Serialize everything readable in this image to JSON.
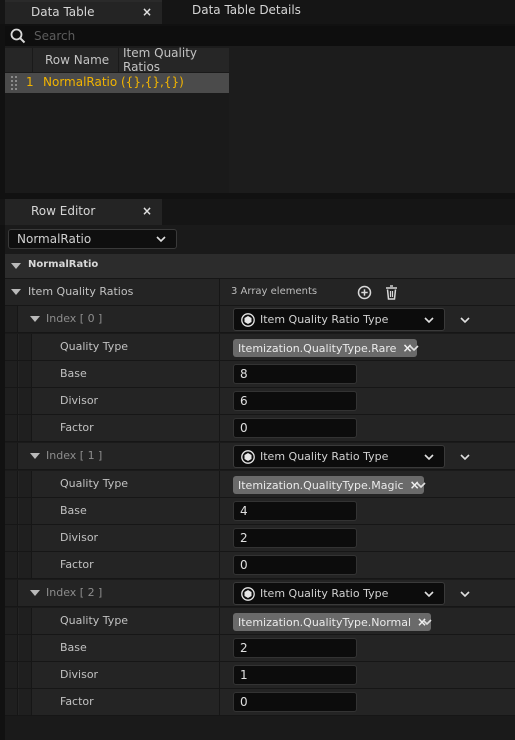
{
  "tabs": {
    "data_table": "Data Table",
    "close_glyph": "×",
    "details": "Data Table Details"
  },
  "search": {
    "placeholder": "Search"
  },
  "table": {
    "headers": [
      "Row Name",
      "Item Quality Ratios"
    ],
    "rows": [
      {
        "index": "1",
        "name": "NormalRatio",
        "value": "({},{},{})"
      }
    ]
  },
  "row_editor": {
    "tab_label": "Row Editor",
    "close_glyph": "×",
    "selected_row": "NormalRatio",
    "section_title": "NormalRatio",
    "array": {
      "label": "Item Quality Ratios",
      "count_text": "3 Array elements",
      "elements": [
        {
          "index_label": "Index [ 0 ]",
          "struct_type": "Item Quality Ratio Type",
          "fields": {
            "quality_type_label": "Quality Type",
            "quality_type_value": "Itemization.QualityType.Rare",
            "base_label": "Base",
            "base_value": "8",
            "divisor_label": "Divisor",
            "divisor_value": "6",
            "factor_label": "Factor",
            "factor_value": "0"
          }
        },
        {
          "index_label": "Index [ 1 ]",
          "struct_type": "Item Quality Ratio Type",
          "fields": {
            "quality_type_label": "Quality Type",
            "quality_type_value": "Itemization.QualityType.Magic",
            "base_label": "Base",
            "base_value": "4",
            "divisor_label": "Divisor",
            "divisor_value": "2",
            "factor_label": "Factor",
            "factor_value": "0"
          }
        },
        {
          "index_label": "Index [ 2 ]",
          "struct_type": "Item Quality Ratio Type",
          "fields": {
            "quality_type_label": "Quality Type",
            "quality_type_value": "Itemization.QualityType.Normal",
            "base_label": "Base",
            "base_value": "2",
            "divisor_label": "Divisor",
            "divisor_value": "1",
            "factor_label": "Factor",
            "factor_value": "0"
          }
        }
      ]
    }
  },
  "icons": {
    "search": "search-icon",
    "add": "plus-circle-icon",
    "delete": "trash-icon",
    "struct": "struct-icon",
    "expand": "triangle-down-icon",
    "dropdown": "chevron-down-icon",
    "grip": "drag-grip-icon"
  },
  "colors": {
    "row_name_highlight": "#f2b400",
    "background": "#1a1a1a"
  }
}
